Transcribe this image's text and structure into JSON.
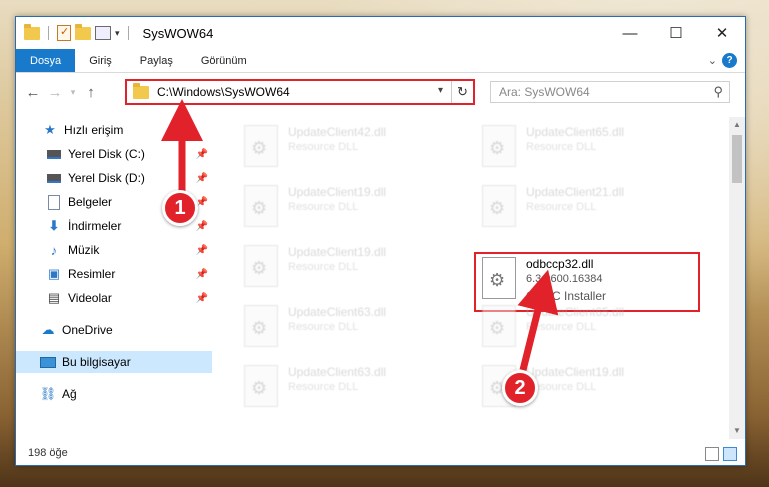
{
  "window": {
    "title": "SysWOW64",
    "controls": {
      "minimize": "—",
      "maximize": "☐",
      "close": "✕"
    }
  },
  "ribbon": {
    "tabs": [
      "Dosya",
      "Giriş",
      "Paylaş",
      "Görünüm"
    ],
    "help": "?"
  },
  "nav": {
    "address": "C:\\Windows\\SysWOW64",
    "search_placeholder": "Ara: SysWOW64"
  },
  "sidebar": {
    "items": [
      {
        "label": "Hızlı erişim",
        "icon": "star-icon"
      },
      {
        "label": "Yerel Disk (C:)",
        "icon": "drive-icon"
      },
      {
        "label": "Yerel Disk (D:)",
        "icon": "drive-icon"
      },
      {
        "label": "Belgeler",
        "icon": "documents-icon"
      },
      {
        "label": "İndirmeler",
        "icon": "download-icon"
      },
      {
        "label": "Müzik",
        "icon": "music-icon"
      },
      {
        "label": "Resimler",
        "icon": "pictures-icon"
      },
      {
        "label": "Videolar",
        "icon": "videos-icon"
      },
      {
        "label": "OneDrive",
        "icon": "onedrive-icon"
      },
      {
        "label": "Bu bilgisayar",
        "icon": "this-pc-icon"
      },
      {
        "label": "Ağ",
        "icon": "network-icon"
      }
    ]
  },
  "files": [
    {
      "name": "UpdateClient42.dll",
      "desc": "Resource DLL"
    },
    {
      "name": "UpdateClient65.dll",
      "desc": "Resource DLL"
    },
    {
      "name": "UpdateClient19.dll",
      "desc": "Resource DLL"
    },
    {
      "name": "UpdateClient21.dll",
      "desc": "Resource DLL"
    },
    {
      "name": "UpdateClient19.dll",
      "desc": "Resource DLL"
    },
    {
      "name": "odbccp32.dll",
      "desc": "6.3.9600.16384",
      "desc2": "ODBC Installer"
    },
    {
      "name": "UpdateClient63.dll",
      "desc": "Resource DLL"
    },
    {
      "name": "UpdateClient65.dll",
      "desc": "Resource DLL"
    },
    {
      "name": "UpdateClient63.dll",
      "desc": "Resource DLL"
    },
    {
      "name": "UpdateClient19.dll",
      "desc": "Resource DLL"
    }
  ],
  "status": {
    "count": "198 öğe"
  },
  "callouts": {
    "one": "1",
    "two": "2"
  },
  "colors": {
    "accent": "#1979ca",
    "highlight": "#e2222a",
    "selected": "#cce8ff"
  }
}
